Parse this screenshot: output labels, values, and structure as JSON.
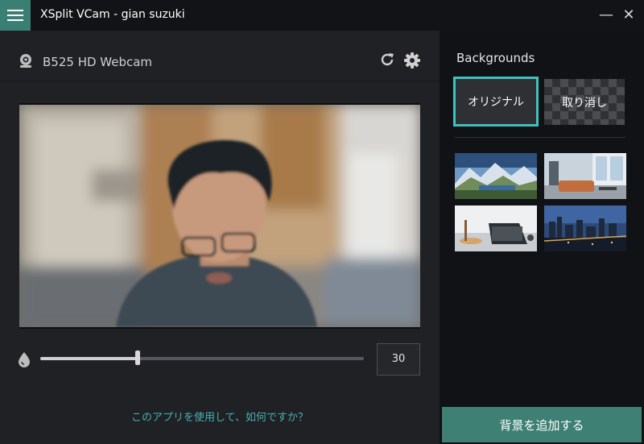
{
  "app": {
    "title": "XSplit VCam - gian suzuki",
    "menu_icon": "hamburger-menu-icon",
    "minimize_glyph": "—",
    "close_glyph": "✕"
  },
  "camera": {
    "name": "B525 HD Webcam",
    "icon": "webcam-icon",
    "refresh_icon": "refresh-icon",
    "settings_icon": "gear-icon"
  },
  "blur": {
    "icon": "droplet-icon",
    "value": "30",
    "fraction": 0.3
  },
  "feedback": {
    "text": "このアプリを使用して、如何ですか？"
  },
  "backgrounds": {
    "heading": "Backgrounds",
    "original_label": "オリジナル",
    "cancel_label": "取り消し",
    "thumbnails": [
      "mountain-lake",
      "living-room",
      "desk-laptop",
      "city-night"
    ]
  },
  "add_button": {
    "label": "背景を追加する"
  },
  "colors": {
    "accent": "#3e8074",
    "selection": "#3cc2c1",
    "link": "#4ab1b3"
  }
}
